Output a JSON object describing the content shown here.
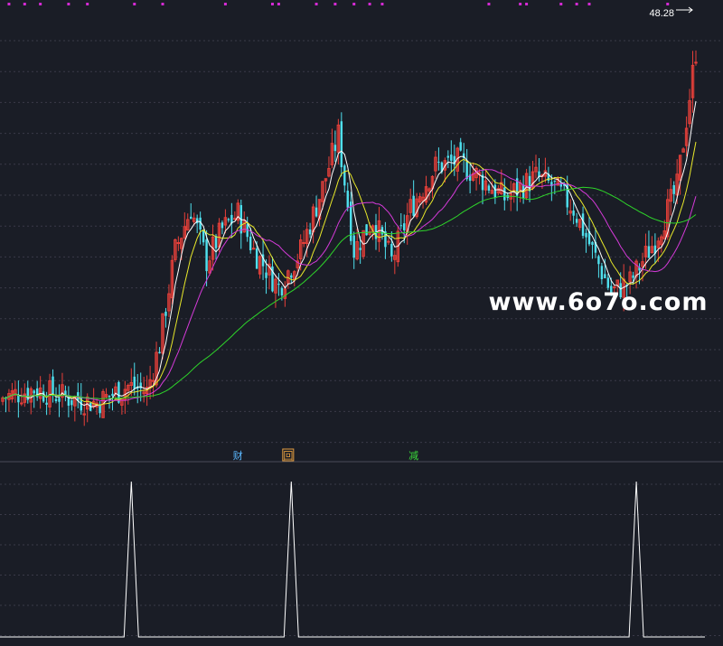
{
  "colors": {
    "background": "#1a1d26",
    "grid": "#3a3a48",
    "candle_up": "#e8403a",
    "candle_down": "#4fe0ee",
    "ma_white": "#ffffff",
    "ma_yellow": "#e8e82a",
    "ma_magenta": "#d43ad8",
    "ma_green": "#2ed42a",
    "spike": "#ffffff",
    "marker": "#d42ad4",
    "label_cai": "#5bb8ff",
    "label_hui_box": "#e8a040",
    "label_jian": "#3ad83a",
    "watermark": "#ffffff"
  },
  "price_label": "48.28",
  "event_labels": [
    {
      "text": "财",
      "candle_index": 75,
      "color_key": "label_cai",
      "boxed": false
    },
    {
      "text": "回",
      "candle_index": 91,
      "color_key": "label_hui_box",
      "boxed": true
    },
    {
      "text": "减",
      "candle_index": 131,
      "color_key": "label_jian",
      "boxed": false
    }
  ],
  "watermark": "www.6o7o.com",
  "chart_data": [
    {
      "type": "candlestick",
      "title": "",
      "price_range": [
        10,
        50
      ],
      "grid": true,
      "num_candles": 222,
      "marked_candles": [
        2,
        7,
        12,
        21,
        27,
        42,
        51,
        71,
        86,
        88,
        100,
        106,
        112,
        117,
        121,
        155,
        165,
        167,
        178,
        183,
        187,
        212
      ],
      "ma_lines": [
        "white",
        "yellow",
        "magenta",
        "green"
      ]
    },
    {
      "type": "line",
      "title": "",
      "y_range": [
        0,
        1
      ],
      "spikes_at_candle": [
        41,
        92,
        202
      ]
    }
  ]
}
